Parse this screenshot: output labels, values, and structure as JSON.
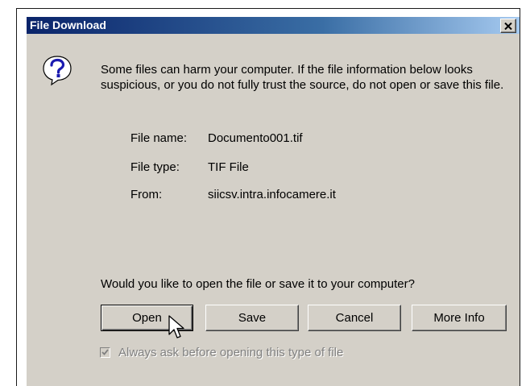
{
  "window": {
    "title": "File Download",
    "close_symbol": "×",
    "titlebar_gradient": [
      "#0a246a",
      "#3a6ea5",
      "#a6caf0"
    ]
  },
  "icons": {
    "dialog_icon": "question-icon",
    "close": "close-icon",
    "checkbox_mark": "checkmark-icon",
    "pointer": "mouse-cursor-icon"
  },
  "message": "Some files can harm your computer. If the file information below looks suspicious, or you do not fully trust the source, do not open or save this file.",
  "file_info": {
    "name_label": "File name:",
    "name_value": "Documento001.tif",
    "type_label": "File type:",
    "type_value": "TIF File",
    "from_label": "From:",
    "from_value": "siicsv.intra.infocamere.it"
  },
  "question": "Would you like to open the file or save it to your computer?",
  "buttons": {
    "open": "Open",
    "save": "Save",
    "cancel": "Cancel",
    "more_info": "More Info"
  },
  "checkbox": {
    "label": "Always ask before opening this type of file",
    "checked": true,
    "disabled": true
  }
}
